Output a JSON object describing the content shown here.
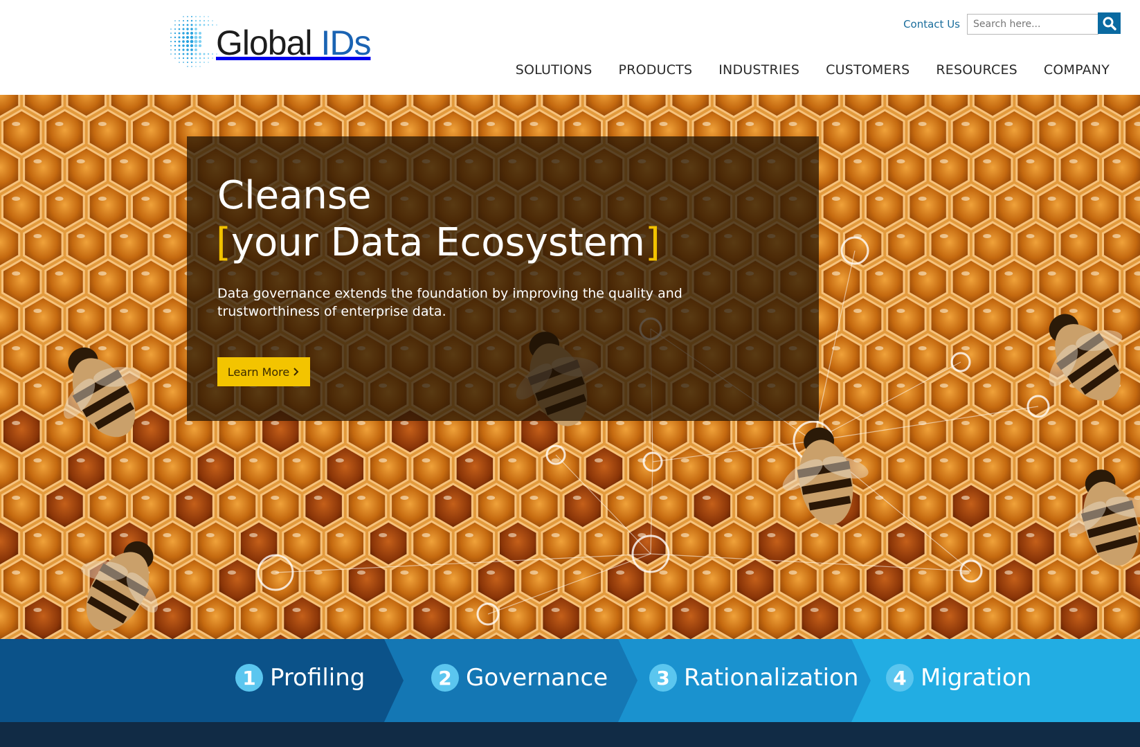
{
  "header": {
    "logo": {
      "text_primary": "Global ",
      "text_accent": "IDs",
      "accent_color": "#1a63b3"
    },
    "contact_label": "Contact Us",
    "search": {
      "placeholder": "Search here...",
      "icon": "search-icon"
    },
    "nav": [
      {
        "label": "SOLUTIONS"
      },
      {
        "label": "PRODUCTS"
      },
      {
        "label": "INDUSTRIES"
      },
      {
        "label": "CUSTOMERS"
      },
      {
        "label": "RESOURCES"
      },
      {
        "label": "COMPANY"
      }
    ]
  },
  "hero": {
    "heading_line1": "Cleanse",
    "heading_line2": "your Data Ecosystem",
    "description": "Data governance extends the foundation by improving the quality and trustworthiness of enterprise data.",
    "cta_label": "Learn More",
    "cta_icon": "chevron-right-icon",
    "background": "honeycomb-with-bees-image",
    "accent_color": "#f2c200"
  },
  "steps": [
    {
      "number": "1",
      "label": "Profiling",
      "color": "#0b5289"
    },
    {
      "number": "2",
      "label": "Governance",
      "color": "#1477b4"
    },
    {
      "number": "3",
      "label": "Rationalization",
      "color": "#1a92cf"
    },
    {
      "number": "4",
      "label": "Migration",
      "color": "#22ade3"
    }
  ]
}
